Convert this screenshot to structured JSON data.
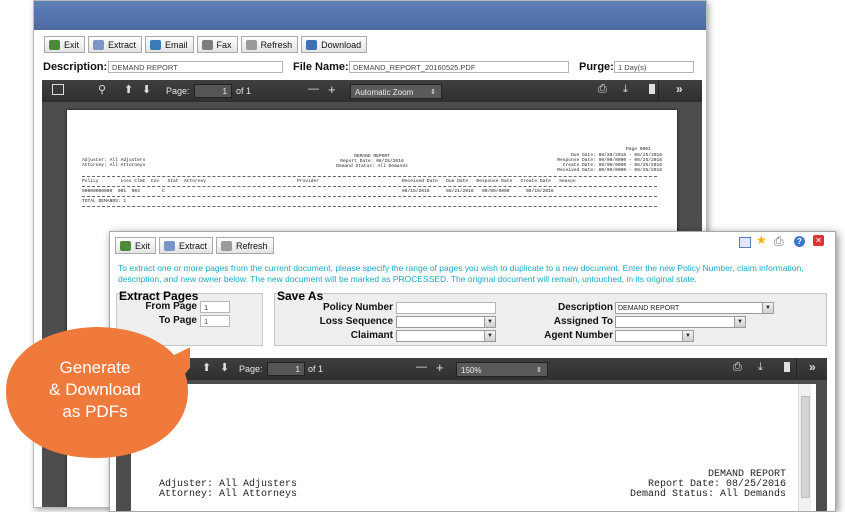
{
  "back": {
    "toolbar": [
      {
        "label": "Exit",
        "icon": "exit-icon",
        "color": "#4c8a3a"
      },
      {
        "label": "Extract",
        "icon": "extract-icon",
        "color": "#7b96c6"
      },
      {
        "label": "Email",
        "icon": "email-icon",
        "color": "#3a7ab8"
      },
      {
        "label": "Fax",
        "icon": "fax-icon",
        "color": "#7c7c7c"
      },
      {
        "label": "Refresh",
        "icon": "refresh-icon",
        "color": "#9a9a9a"
      },
      {
        "label": "Download",
        "icon": "download-icon",
        "color": "#3e6fb0"
      }
    ],
    "description_label": "Description:",
    "description_value": "DEMAND REPORT",
    "filename_label": "File Name:",
    "filename_value": "DEMAND_REPORT_20160525.PDF",
    "purge_label": "Purge:",
    "purge_value": "1 Day(s)",
    "viewer": {
      "page_label": "Page:",
      "page_value": "1",
      "of_pages": "of 1",
      "zoom": "Automatic Zoom",
      "minus": "—",
      "plus": "+"
    },
    "report": {
      "page_no": "Page 0001",
      "title": "DEMAND REPORT",
      "report_date": "Report Date: 08/25/2016",
      "demand_status": "Demand Status: All Demands",
      "adjuster": "Adjuster: All Adjusters",
      "attorney": "Attorney: All Attorneys",
      "due_date": "Due Date: 08/20/2016 - 08/25/2016",
      "response_date": "Response Date: 00/00/0000 - 08/25/2016",
      "create_date": "Create Date: 00/00/0000 - 08/25/2016",
      "received_date": "Received Date: 00/00/0000 - 08/25/2016",
      "columns": "Policy        Loss Clmt  Cov   Stat  Attorney",
      "col_provider": "Provider",
      "col_dates": "Received Date   Due Date   Response Date   Create Date   Season",
      "row_left": "00000000000  001  003        C",
      "row_dates": "08/16/2016      08/21/2016   00/00/0000      08/16/2016",
      "total": "TOTAL DEMANDS: 1"
    }
  },
  "front": {
    "toolbar": [
      {
        "label": "Exit",
        "icon": "exit-icon",
        "color": "#4c8a3a"
      },
      {
        "label": "Extract",
        "icon": "extract-icon",
        "color": "#7b96c6"
      },
      {
        "label": "Refresh",
        "icon": "refresh-icon",
        "color": "#9a9a9a"
      }
    ],
    "instructions": "To extract one or more pages from the current document, please specify the range of pages you wish to duplicate to a new document. Enter the new Policy Number, claim information, description, and new owner below. The new document will be marked as PROCESSED. The original document will remain, untouched, in its original state.",
    "extract_pages_title": "Extract Pages",
    "from_page_label": "From Page",
    "from_page_value": "1",
    "to_page_label": "To Page",
    "to_page_value": "1",
    "save_as_title": "Save As",
    "policy_number_label": "Policy Number",
    "loss_sequence_label": "Loss Sequence",
    "claimant_label": "Claimant",
    "description_label": "Description",
    "description_value": "DEMAND REPORT",
    "assigned_to_label": "Assigned To",
    "agent_number_label": "Agent Number",
    "viewer": {
      "page_label": "Page:",
      "page_value": "1",
      "of_pages": "of 1",
      "zoom": "150%",
      "minus": "—",
      "plus": "+"
    },
    "report": {
      "title": "DEMAND REPORT",
      "report_date": "Report Date: 08/25/2016",
      "demand_status": "Demand Status: All Demands",
      "adjuster": "Adjuster: All Adjusters",
      "attorney": "Attorney: All Attorneys"
    }
  },
  "callout": {
    "line1": "Generate",
    "line2": "& Download",
    "line3": "as PDFs",
    "color": "#f07a3c"
  }
}
